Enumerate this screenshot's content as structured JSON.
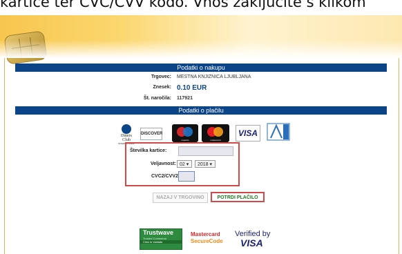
{
  "caption": "kartice ter CVC/CVV kodo. Vnos zaključite s klikom",
  "purchase": {
    "section_title": "Podatki o nakupu",
    "merchant_label": "Trgovec:",
    "merchant_value": "MESTNA KNJIZNICA LJUBLJANA",
    "amount_label": "Znesek:",
    "amount_value": "0.10 EUR",
    "order_label": "Št. naročila:",
    "order_value": "117921"
  },
  "payment": {
    "section_title": "Podatki o plačilu",
    "card_logos": [
      "Diners Club",
      "DISCOVER",
      "maestro",
      "mastercard",
      "VISA",
      "American Express"
    ],
    "diners_text": "Diners Club",
    "diners_sub": "INTERNATIONAL",
    "discover_text": "DISCOVER",
    "maestro_text": "maestro",
    "mastercard_text": "mastercard",
    "visa_text": "VISA",
    "card_number_label": "Številka kartice:",
    "expiry_label": "Veljavnost:",
    "expiry_month": "02",
    "expiry_year": "2018",
    "cvc_label": "CVC2/CVV2:"
  },
  "buttons": {
    "back": "NAZAJ V TRGOVINO",
    "confirm": "POTRDI PLAČILO"
  },
  "badges": {
    "trustwave": "Trustwave",
    "trustwave_sub1": "Trusted Commerce",
    "trustwave_sub2": "Click to Validate",
    "mc_line1": "Mastercard",
    "mc_line2": "SecureCode",
    "visa_line1": "Verified by",
    "visa_line2": "VISA"
  },
  "colors": {
    "navy": "#0b4487",
    "highlight": "#d04848",
    "confirm_green": "#1f7a1f"
  }
}
